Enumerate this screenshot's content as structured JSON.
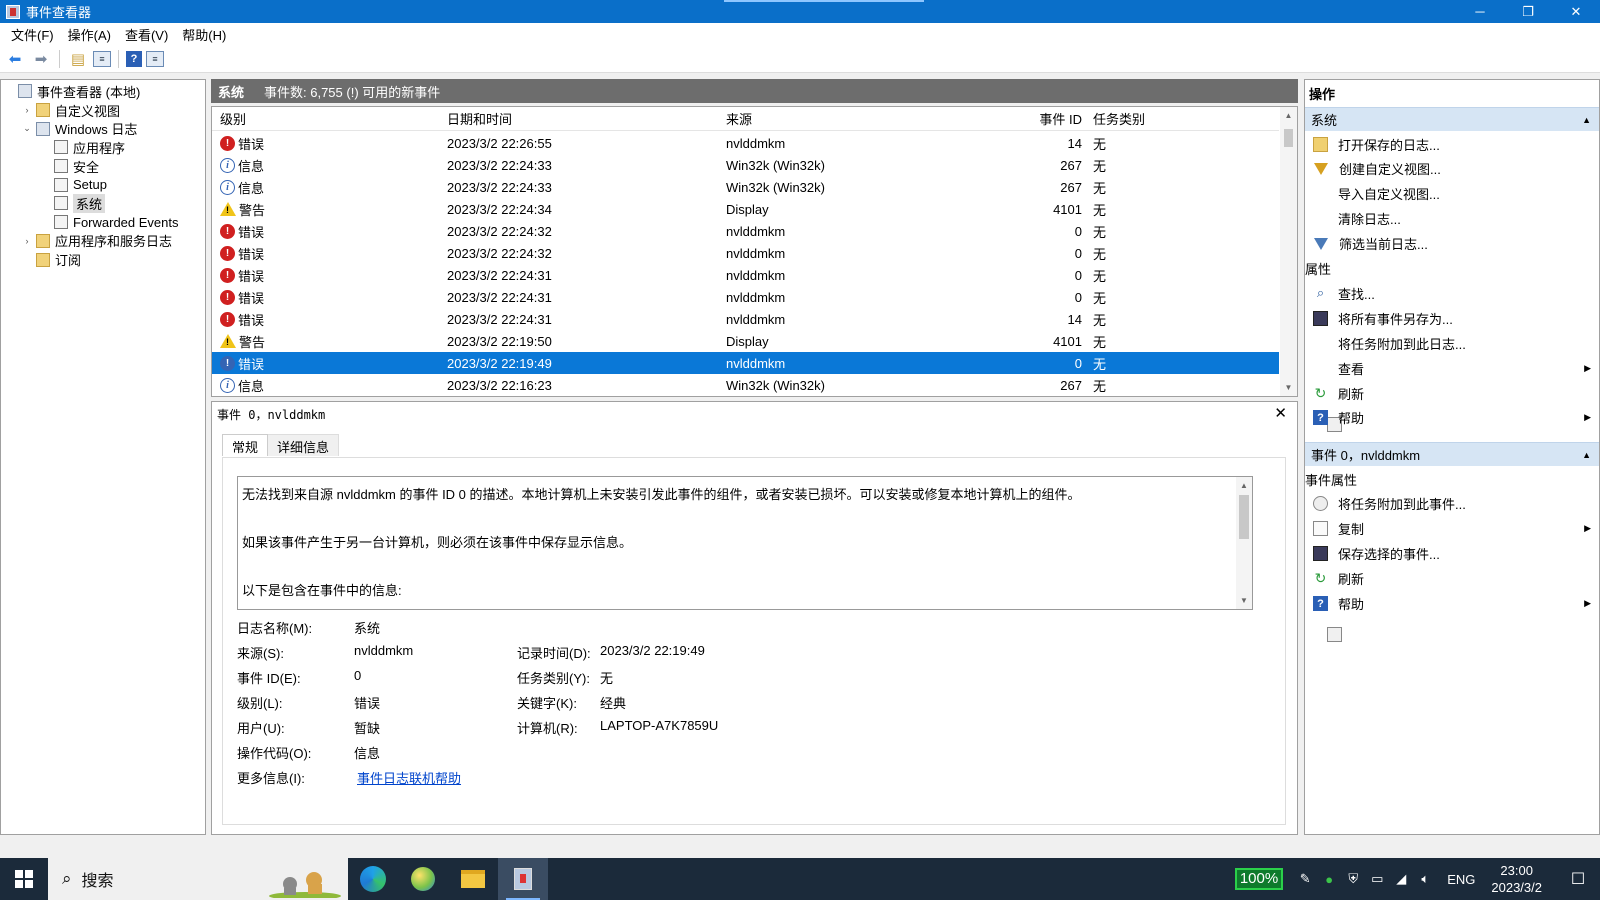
{
  "window": {
    "title": "事件查看器",
    "minimize": "─",
    "restore": "❐",
    "close": "✕"
  },
  "menu": [
    "文件(F)",
    "操作(A)",
    "查看(V)",
    "帮助(H)"
  ],
  "tree": [
    {
      "label": "事件查看器 (本地)",
      "indent": 0,
      "expander": "",
      "icon": "root"
    },
    {
      "label": "自定义视图",
      "indent": 1,
      "expander": "›",
      "icon": "folder"
    },
    {
      "label": "Windows 日志",
      "indent": 1,
      "expander": "⌄",
      "icon": "root"
    },
    {
      "label": "应用程序",
      "indent": 2,
      "expander": "",
      "icon": "log"
    },
    {
      "label": "安全",
      "indent": 2,
      "expander": "",
      "icon": "log"
    },
    {
      "label": "Setup",
      "indent": 2,
      "expander": "",
      "icon": "log"
    },
    {
      "label": "系统",
      "indent": 2,
      "expander": "",
      "icon": "log",
      "selected": true
    },
    {
      "label": "Forwarded Events",
      "indent": 2,
      "expander": "",
      "icon": "log"
    },
    {
      "label": "应用程序和服务日志",
      "indent": 1,
      "expander": "›",
      "icon": "folder"
    },
    {
      "label": "订阅",
      "indent": 1,
      "expander": "",
      "icon": "folder"
    }
  ],
  "center": {
    "title": "系统",
    "summary": "事件数: 6,755 (!) 可用的新事件"
  },
  "events": {
    "columns": {
      "level": "级别",
      "date": "日期和时间",
      "source": "来源",
      "id": "事件 ID",
      "task": "任务类别"
    },
    "rows": [
      {
        "level": "错误",
        "type": "error",
        "date": "2023/3/2 22:26:55",
        "source": "nvlddmkm",
        "id": "14",
        "task": "无"
      },
      {
        "level": "信息",
        "type": "info",
        "date": "2023/3/2 22:24:33",
        "source": "Win32k (Win32k)",
        "id": "267",
        "task": "无"
      },
      {
        "level": "信息",
        "type": "info",
        "date": "2023/3/2 22:24:33",
        "source": "Win32k (Win32k)",
        "id": "267",
        "task": "无"
      },
      {
        "level": "警告",
        "type": "warn",
        "date": "2023/3/2 22:24:34",
        "source": "Display",
        "id": "4101",
        "task": "无"
      },
      {
        "level": "错误",
        "type": "error",
        "date": "2023/3/2 22:24:32",
        "source": "nvlddmkm",
        "id": "0",
        "task": "无"
      },
      {
        "level": "错误",
        "type": "error",
        "date": "2023/3/2 22:24:32",
        "source": "nvlddmkm",
        "id": "0",
        "task": "无"
      },
      {
        "level": "错误",
        "type": "error",
        "date": "2023/3/2 22:24:31",
        "source": "nvlddmkm",
        "id": "0",
        "task": "无"
      },
      {
        "level": "错误",
        "type": "error",
        "date": "2023/3/2 22:24:31",
        "source": "nvlddmkm",
        "id": "0",
        "task": "无"
      },
      {
        "level": "错误",
        "type": "error",
        "date": "2023/3/2 22:24:31",
        "source": "nvlddmkm",
        "id": "14",
        "task": "无"
      },
      {
        "level": "警告",
        "type": "warn",
        "date": "2023/3/2 22:19:50",
        "source": "Display",
        "id": "4101",
        "task": "无"
      },
      {
        "level": "错误",
        "type": "error",
        "date": "2023/3/2 22:19:49",
        "source": "nvlddmkm",
        "id": "0",
        "task": "无",
        "selected": true
      },
      {
        "level": "信息",
        "type": "info",
        "date": "2023/3/2 22:16:23",
        "source": "Win32k (Win32k)",
        "id": "267",
        "task": "无"
      }
    ]
  },
  "detail": {
    "title": "事件 0，nvlddmkm",
    "close": "✕",
    "tabs": [
      "常规",
      "详细信息"
    ],
    "description": [
      "无法找到来自源 nvlddmkm 的事件 ID 0 的描述。本地计算机上未安装引发此事件的组件，或者安装已损坏。可以安装或修复本地计算机上的组件。",
      "如果该事件产生于另一台计算机，则必须在该事件中保存显示信息。",
      "以下是包含在事件中的信息:"
    ],
    "props": {
      "log_name_label": "日志名称(M):",
      "log_name": "系统",
      "source_label": "来源(S):",
      "source": "nvlddmkm",
      "logged_label": "记录时间(D):",
      "logged": "2023/3/2 22:19:49",
      "event_id_label": "事件 ID(E):",
      "event_id": "0",
      "task_label": "任务类别(Y):",
      "task": "无",
      "level_label": "级别(L):",
      "level": "错误",
      "keywords_label": "关键字(K):",
      "keywords": "经典",
      "user_label": "用户(U):",
      "user": "暂缺",
      "computer_label": "计算机(R):",
      "computer": "LAPTOP-A7K7859U",
      "opcode_label": "操作代码(O):",
      "opcode": "信息",
      "more_label": "更多信息(I):",
      "more_link": "事件日志联机帮助"
    }
  },
  "actions": {
    "title": "操作",
    "section1": "系统",
    "items1": [
      {
        "label": "打开保存的日志...",
        "icon": "open"
      },
      {
        "label": "创建自定义视图...",
        "icon": "filter"
      },
      {
        "label": "导入自定义视图...",
        "icon": "blank"
      },
      {
        "label": "清除日志...",
        "icon": "blank"
      },
      {
        "label": "筛选当前日志...",
        "icon": "filter2"
      },
      {
        "label": "属性",
        "icon": "props"
      },
      {
        "label": "查找...",
        "icon": "find"
      },
      {
        "label": "将所有事件另存为...",
        "icon": "save"
      },
      {
        "label": "将任务附加到此日志...",
        "icon": "blank"
      },
      {
        "label": "查看",
        "icon": "blank",
        "submenu": true
      },
      {
        "label": "刷新",
        "icon": "refresh"
      },
      {
        "label": "帮助",
        "icon": "help",
        "submenu": true
      }
    ],
    "section2": "事件 0，nvlddmkm",
    "items2": [
      {
        "label": "事件属性",
        "icon": "props"
      },
      {
        "label": "将任务附加到此事件...",
        "icon": "task"
      },
      {
        "label": "复制",
        "icon": "copy",
        "submenu": true
      },
      {
        "label": "保存选择的事件...",
        "icon": "save"
      },
      {
        "label": "刷新",
        "icon": "refresh"
      },
      {
        "label": "帮助",
        "icon": "help",
        "submenu": true
      }
    ]
  },
  "taskbar": {
    "search_placeholder": "搜索",
    "battery": "100%",
    "lang": "ENG",
    "time": "23:00",
    "date": "2023/3/2"
  }
}
